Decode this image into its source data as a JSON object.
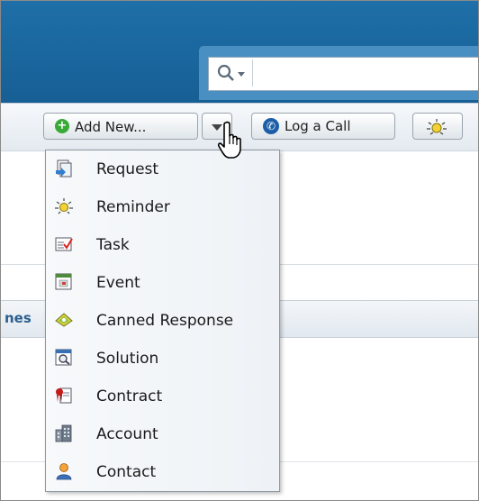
{
  "toolbar": {
    "add_new_label": "Add New...",
    "log_call_label": "Log a Call"
  },
  "tab_fragment": "nes",
  "menu": {
    "items": [
      {
        "label": "Request",
        "icon": "request-icon"
      },
      {
        "label": "Reminder",
        "icon": "reminder-icon"
      },
      {
        "label": "Task",
        "icon": "task-icon"
      },
      {
        "label": "Event",
        "icon": "event-icon"
      },
      {
        "label": "Canned Response",
        "icon": "canned-response-icon"
      },
      {
        "label": "Solution",
        "icon": "solution-icon"
      },
      {
        "label": "Contract",
        "icon": "contract-icon"
      },
      {
        "label": "Account",
        "icon": "account-icon"
      },
      {
        "label": "Contact",
        "icon": "contact-icon"
      }
    ]
  },
  "colors": {
    "header_blue": "#1f6fa8",
    "accent_green": "#39a938",
    "link_blue": "#2a5f8f"
  }
}
